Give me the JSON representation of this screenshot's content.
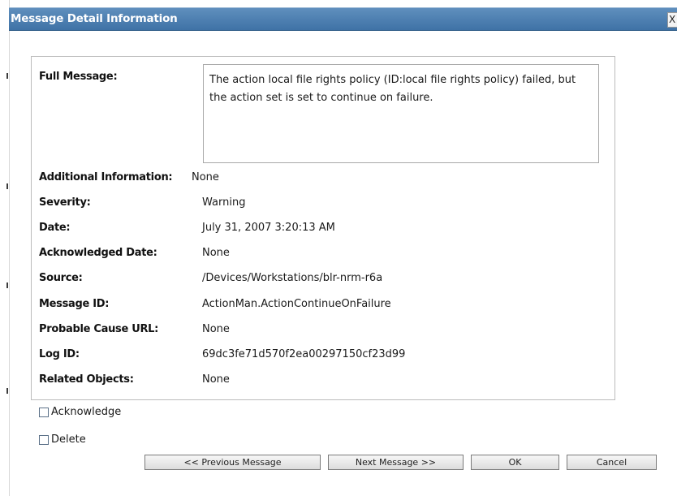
{
  "dialog": {
    "title": "Message Detail Information",
    "close_label": "X"
  },
  "details": {
    "full_message_label": "Full Message:",
    "full_message": "The action local file rights policy (ID:local file rights policy) failed, but the action set is set to continue on failure.",
    "rows": [
      {
        "label": "Additional Information:",
        "value": "None"
      },
      {
        "label": "Severity:",
        "value": "Warning"
      },
      {
        "label": "Date:",
        "value": "July 31, 2007 3:20:13 AM"
      },
      {
        "label": "Acknowledged Date:",
        "value": "None"
      },
      {
        "label": "Source:",
        "value": "/Devices/Workstations/blr-nrm-r6a"
      },
      {
        "label": "Message ID:",
        "value": "ActionMan.ActionContinueOnFailure"
      },
      {
        "label": "Probable Cause URL:",
        "value": "None"
      },
      {
        "label": "Log ID:",
        "value": "69dc3fe71d570f2ea00297150cf23d99"
      },
      {
        "label": "Related Objects:",
        "value": "None"
      }
    ]
  },
  "options": {
    "acknowledge": {
      "label": "Acknowledge",
      "checked": false
    },
    "delete": {
      "label": "Delete",
      "checked": false
    }
  },
  "buttons": {
    "previous": "<< Previous Message",
    "next": "Next Message >>",
    "ok": "OK",
    "cancel": "Cancel"
  },
  "colors": {
    "titlebar": "#4a7eb1",
    "title_text": "#ffffff"
  }
}
